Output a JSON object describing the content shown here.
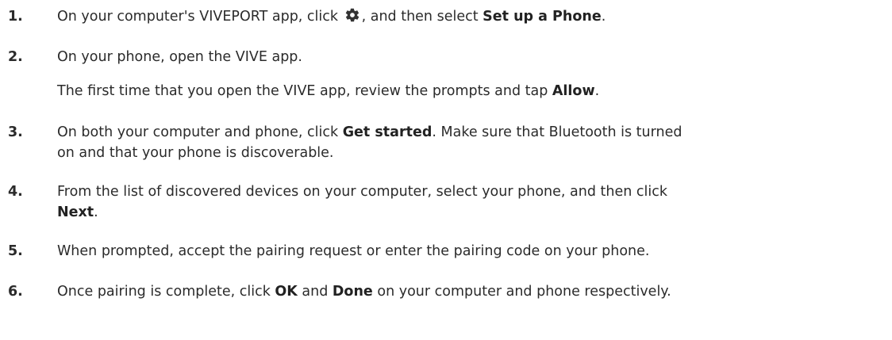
{
  "steps": [
    {
      "number": "1.",
      "pre": "On your computer's VIVEPORT app, click ",
      "icon": "gear-icon",
      "mid": ", and then select ",
      "bold": "Set up a Phone",
      "post": "."
    },
    {
      "number": "2.",
      "line1": "On your phone, open the VIVE app.",
      "line2_pre": "The first time that you open the VIVE app, review the prompts and tap ",
      "line2_bold": "Allow",
      "line2_post": "."
    },
    {
      "number": "3.",
      "pre": "On both your computer and phone, click ",
      "bold": "Get started",
      "post1": ". Make sure that Bluetooth is turned",
      "line2": "on and that your phone is discoverable."
    },
    {
      "number": "4.",
      "line1": "From the list of discovered devices on your computer, select your phone, and then click",
      "line2_bold": "Next",
      "line2_post": "."
    },
    {
      "number": "5.",
      "text": "When prompted, accept the pairing request or enter the pairing code on your phone."
    },
    {
      "number": "6.",
      "pre": "Once pairing is complete, click ",
      "bold1": "OK",
      "mid": " and ",
      "bold2": "Done",
      "post": " on your computer and phone respectively."
    }
  ]
}
